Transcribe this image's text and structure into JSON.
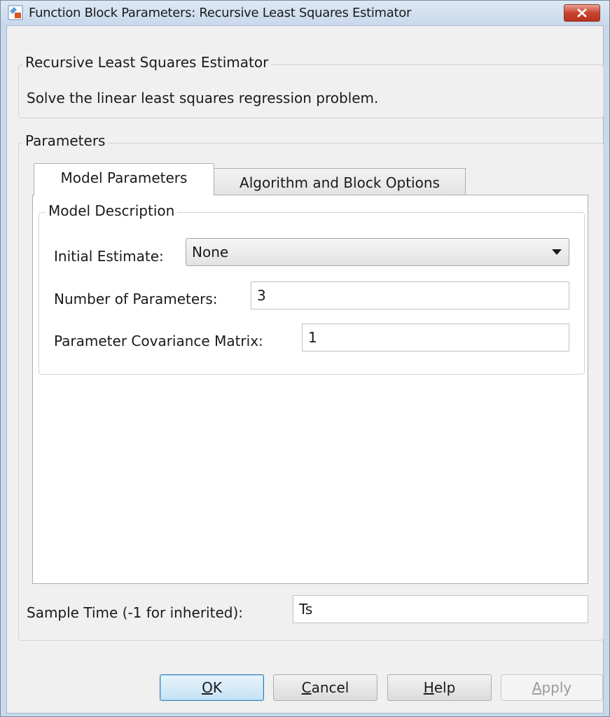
{
  "window": {
    "title": "Function Block Parameters: Recursive Least Squares Estimator"
  },
  "description": {
    "group_title": "Recursive Least Squares Estimator",
    "text": "Solve the linear least squares regression problem."
  },
  "parameters": {
    "group_title": "Parameters",
    "tabs": [
      {
        "label": "Model Parameters",
        "active": true
      },
      {
        "label": "Algorithm and Block Options",
        "active": false
      }
    ],
    "model_description": {
      "group_title": "Model Description",
      "initial_estimate": {
        "label": "Initial Estimate:",
        "value": "None"
      },
      "number_of_parameters": {
        "label": "Number of Parameters:",
        "value": "3"
      },
      "covariance_matrix": {
        "label": "Parameter Covariance Matrix:",
        "value": "1"
      }
    },
    "sample_time": {
      "label": "Sample Time (-1 for inherited):",
      "value": "Ts"
    }
  },
  "buttons": {
    "ok": {
      "mnemonic": "O",
      "rest": "K"
    },
    "cancel": {
      "mnemonic": "C",
      "rest": "ancel"
    },
    "help": {
      "mnemonic": "H",
      "rest": "elp"
    },
    "apply": {
      "mnemonic": "A",
      "rest": "pply"
    }
  },
  "icons": {
    "title_icon": "simulink-block-icon",
    "close": "close-icon",
    "dropdown": "chevron-down-icon"
  },
  "colors": {
    "title_bar": "#c9d9ec",
    "close_button": "#c9432f",
    "default_button": "#c5e2f5"
  }
}
